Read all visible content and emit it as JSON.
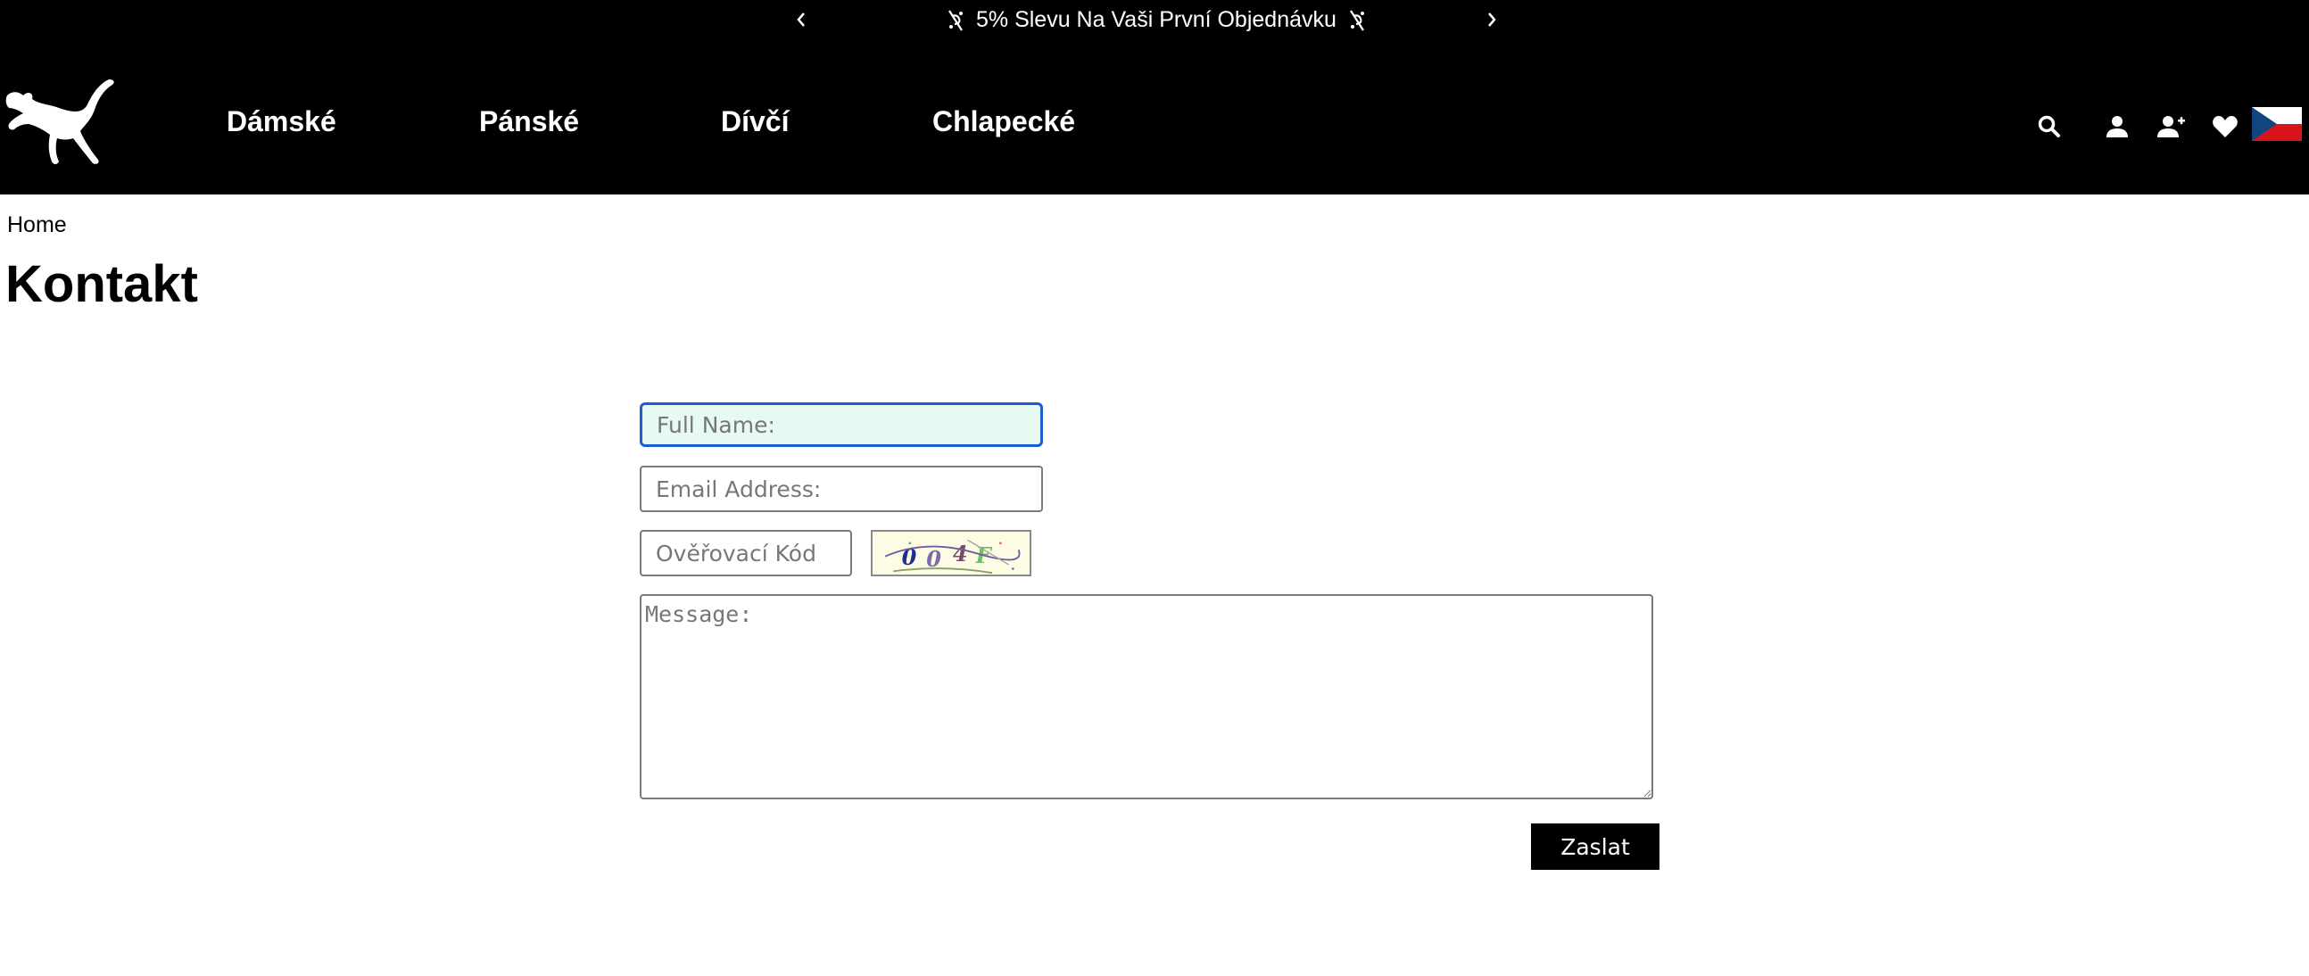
{
  "promo": {
    "text": "5% Slevu Na Vaši První Objednávku",
    "prev_icon": "chevron-left-icon",
    "next_icon": "chevron-right-icon",
    "decor_icon": "discount-tag-icon"
  },
  "header": {
    "logo": "puma-logo",
    "nav": [
      "Dámské",
      "Pánské",
      "Dívčí",
      "Chlapecké"
    ],
    "icons": [
      "search-icon",
      "user-icon",
      "register-icon",
      "wishlist-heart-icon",
      "czech-flag-icon"
    ]
  },
  "breadcrumb": {
    "home": "Home"
  },
  "page": {
    "title": "Kontakt"
  },
  "form": {
    "name_placeholder": "Full Name:",
    "email_placeholder": "Email Address:",
    "code_placeholder": "Ověřovací Kód",
    "captcha_text": "004F",
    "message_placeholder": "Message:",
    "submit_label": "Zaslat"
  },
  "colors": {
    "header_bg": "#000000",
    "focus_border": "#1f5bd1",
    "focus_fill": "#e6faf1",
    "button_bg": "#000000"
  }
}
